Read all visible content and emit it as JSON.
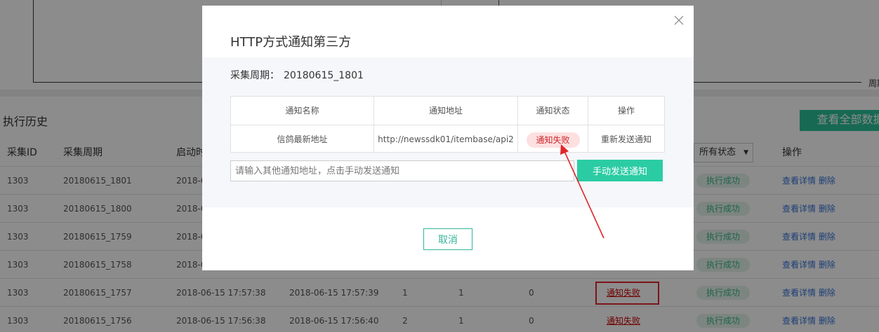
{
  "chart": {
    "xlabel": "周期"
  },
  "history": {
    "title": "执行历史",
    "view_all_label": "查看全部数据",
    "columns": [
      "采集ID",
      "采集周期",
      "启动时",
      "",
      "",
      "",
      "",
      "",
      "",
      "操作"
    ],
    "status_filter": "所有状态",
    "rows": [
      {
        "id": "1303",
        "period": "20180615_1801",
        "start": "2018-0",
        "end": "",
        "c1": "",
        "c2": "",
        "c3": "",
        "notify": "",
        "status": "执行成功",
        "op_detail": "查看详情",
        "op_delete": "删除"
      },
      {
        "id": "1303",
        "period": "20180615_1800",
        "start": "2018-0",
        "end": "",
        "c1": "",
        "c2": "",
        "c3": "",
        "notify": "",
        "status": "执行成功",
        "op_detail": "查看详情",
        "op_delete": "删除"
      },
      {
        "id": "1303",
        "period": "20180615_1759",
        "start": "2018-0",
        "end": "",
        "c1": "",
        "c2": "",
        "c3": "",
        "notify": "",
        "status": "执行成功",
        "op_detail": "查看详情",
        "op_delete": "删除"
      },
      {
        "id": "1303",
        "period": "20180615_1758",
        "start": "2018-0",
        "end": "",
        "c1": "",
        "c2": "",
        "c3": "",
        "notify": "",
        "status": "执行成功",
        "op_detail": "查看详情",
        "op_delete": "删除"
      },
      {
        "id": "1303",
        "period": "20180615_1757",
        "start": "2018-06-15 17:57:38",
        "end": "2018-06-15 17:57:39",
        "c1": "1",
        "c2": "1",
        "c3": "0",
        "notify": "通知失败",
        "status": "执行成功",
        "op_detail": "查看详情",
        "op_delete": "删除"
      },
      {
        "id": "1303",
        "period": "20180615_1756",
        "start": "2018-06-15 17:56:38",
        "end": "2018-06-15 17:56:40",
        "c1": "2",
        "c2": "1",
        "c3": "0",
        "notify": "通知失败",
        "status": "执行成功",
        "op_detail": "查看详情",
        "op_delete": "删除"
      }
    ]
  },
  "modal": {
    "title": "HTTP方式通知第三方",
    "period_label": "采集周期：",
    "period_value": "20180615_1801",
    "table": {
      "headers": [
        "通知名称",
        "通知地址",
        "通知状态",
        "操作"
      ],
      "row": {
        "name": "信鸽最新地址",
        "url": "http://newssdk01/itembase/api2",
        "status": "通知失败",
        "action": "重新发送通知"
      }
    },
    "input_placeholder": "请输入其他通知地址，点击手动发送通知",
    "input_value": "",
    "send_label": "手动发送通知",
    "cancel_label": "取消"
  },
  "annotation": {
    "arrow_color": "#e0262b"
  }
}
